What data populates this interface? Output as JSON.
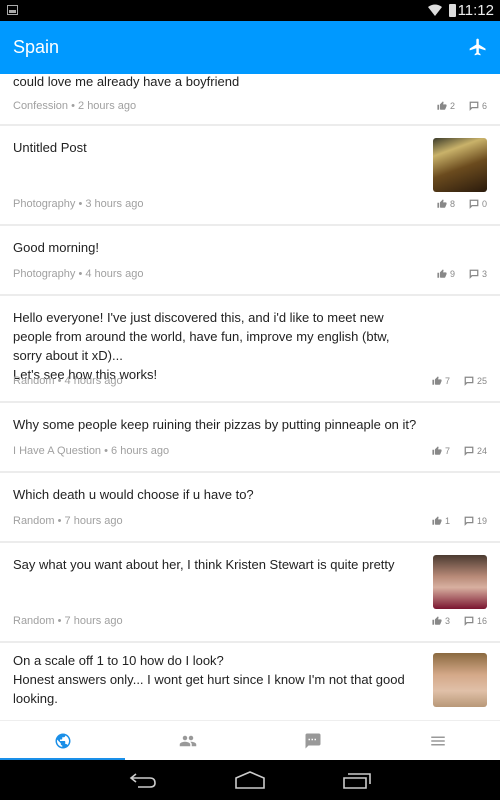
{
  "status_bar": {
    "time": "11:12"
  },
  "app_bar": {
    "title": "Spain",
    "action_icon": "airplane-icon"
  },
  "colors": {
    "primary": "#0099ff",
    "active_tab": "#1a8fe8",
    "meta_text": "#a0a0a0"
  },
  "posts": [
    {
      "text": "could love me already have a boyfriend",
      "category": "Confession",
      "time": "2 hours ago",
      "likes": "2",
      "comments": "6",
      "thumbnail": null
    },
    {
      "text": "Untitled Post",
      "category": "Photography",
      "time": "3 hours ago",
      "likes": "8",
      "comments": "0",
      "thumbnail": "boardwalk-photo"
    },
    {
      "text": "Good morning!",
      "category": "Photography",
      "time": "4 hours ago",
      "likes": "9",
      "comments": "3",
      "thumbnail": null
    },
    {
      "text": "Hello everyone! I've just discovered this, and i'd like to meet new people from around the world, have fun, improve my english (btw, sorry about it xD)...\nLet's see how this works!",
      "category": "Random",
      "time": "4 hours ago",
      "likes": "7",
      "comments": "25",
      "thumbnail": null
    },
    {
      "text": "Why some people keep ruining their pizzas by putting pinneaple on it?",
      "category": "I Have A Question",
      "time": "6 hours ago",
      "likes": "7",
      "comments": "24",
      "thumbnail": null
    },
    {
      "text": "Which death u would choose if u have to?",
      "category": "Random",
      "time": "7 hours ago",
      "likes": "1",
      "comments": "19",
      "thumbnail": null
    },
    {
      "text": "Say what you want about her, I think Kristen Stewart is quite pretty",
      "category": "Random",
      "time": "7 hours ago",
      "likes": "3",
      "comments": "16",
      "thumbnail": "woman-portrait-photo"
    },
    {
      "text": "On a scale off 1 to 10 how do I look?\nHonest answers only... I wont get hurt since I know I'm not that good looking.",
      "category": "",
      "time": "",
      "likes": "",
      "comments": "",
      "thumbnail": "selfie-photo"
    }
  ],
  "meta_separator": " • ",
  "tabs": [
    {
      "name": "globe",
      "icon": "globe-icon",
      "active": true
    },
    {
      "name": "people",
      "icon": "people-icon",
      "active": false
    },
    {
      "name": "chat",
      "icon": "chat-icon",
      "active": false
    },
    {
      "name": "menu",
      "icon": "menu-icon",
      "active": false
    }
  ],
  "nav_buttons": [
    "back",
    "home",
    "recents"
  ]
}
